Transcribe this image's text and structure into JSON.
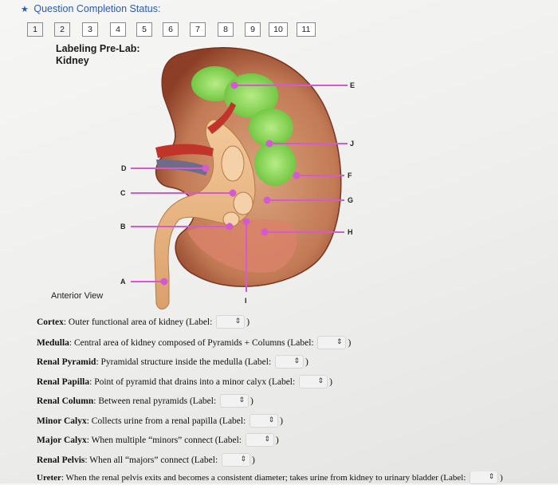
{
  "status": {
    "label": "Question Completion Status:"
  },
  "question_nav": [
    "1",
    "2",
    "3",
    "4",
    "5",
    "6",
    "7",
    "8",
    "9",
    "10",
    "11"
  ],
  "title": {
    "line1": "Labeling Pre-Lab:",
    "line2": "Kidney"
  },
  "diagram": {
    "labels": {
      "A": "A",
      "B": "B",
      "C": "C",
      "D": "D",
      "E": "E",
      "F": "F",
      "G": "G",
      "H": "H",
      "I": "I",
      "J": "J"
    },
    "caption": "Anterior View",
    "colors": {
      "leader_line": "#d45ad0",
      "cortex": "#c8825f",
      "medulla": "#8ed65a",
      "pelvis": "#e8b27a",
      "vessel_red": "#c0342a"
    }
  },
  "questions": [
    {
      "term": "Cortex",
      "desc": ": Outer functional area of kidney (Label: ",
      "close": ")"
    },
    {
      "term": "Medulla",
      "desc": ": Central area of kidney composed of Pyramids + Columns (Label: ",
      "close": ")"
    },
    {
      "term": "Renal Pyramid",
      "desc": ": Pyramidal structure inside the medulla (Label: ",
      "close": ")"
    },
    {
      "term": "Renal Papilla",
      "desc": ": Point of pyramid that drains into a minor calyx (Label: ",
      "close": ")"
    },
    {
      "term": "Renal Column",
      "desc": ": Between renal pyramids (Label: ",
      "close": ")"
    },
    {
      "term": "Minor Calyx",
      "desc": ": Collects urine from a renal papilla (Label: ",
      "close": ")"
    },
    {
      "term": "Major Calyx",
      "desc": ": When multiple “minors” connect (Label: ",
      "close": ")"
    },
    {
      "term": "Renal Pelvis",
      "desc": ": When all “majors” connect (Label: ",
      "close": ")"
    },
    {
      "term": "Ureter",
      "desc": ": When the renal pelvis exits and becomes a consistent diameter; takes urine from kidney to urinary bladder (Label: ",
      "close": ")"
    }
  ]
}
